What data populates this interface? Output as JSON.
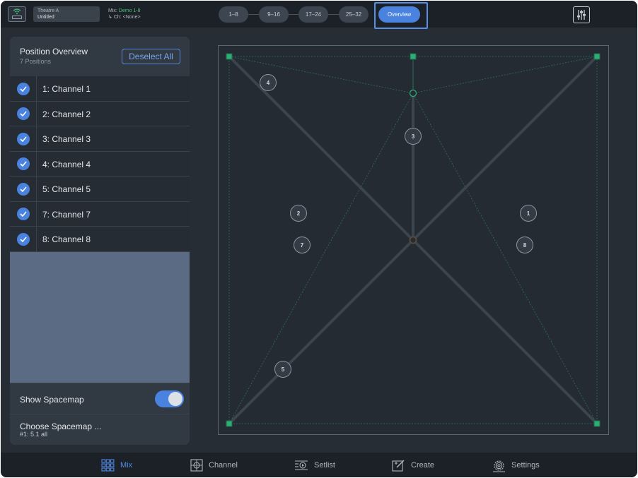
{
  "topbar": {
    "venue_name": "Theatre A",
    "venue_file": "Untitled",
    "mix_label": "Mix:",
    "mix_value": "Demo 1-8",
    "channel_label": "Ch: <None>",
    "pages": [
      "1–8",
      "9–16",
      "17–24",
      "25–32"
    ],
    "overview_label": "Overview"
  },
  "panel": {
    "title": "Position Overview",
    "subtitle": "7 Positions",
    "deselect_label": "Deselect All",
    "channels": [
      {
        "label": "1: Channel 1",
        "checked": true
      },
      {
        "label": "2: Channel 2",
        "checked": true
      },
      {
        "label": "3: Channel 3",
        "checked": true
      },
      {
        "label": "4: Channel 4",
        "checked": true
      },
      {
        "label": "5: Channel 5",
        "checked": true
      },
      {
        "label": "7: Channel 7",
        "checked": true
      },
      {
        "label": "8: Channel 8",
        "checked": true
      }
    ],
    "show_spacemap_label": "Show Spacemap",
    "show_spacemap_on": true,
    "choose_spacemap_label": "Choose Spacemap ...",
    "choose_spacemap_value": "#1: 5.1 all"
  },
  "map": {
    "positions": [
      "4",
      "3",
      "2",
      "1",
      "7",
      "8",
      "5"
    ]
  },
  "tabs": [
    {
      "label": "Mix",
      "icon": "grid-icon",
      "active": true
    },
    {
      "label": "Channel",
      "icon": "crosshair-icon",
      "active": false
    },
    {
      "label": "Setlist",
      "icon": "setlist-icon",
      "active": false
    },
    {
      "label": "Create",
      "icon": "create-icon",
      "active": false
    },
    {
      "label": "Settings",
      "icon": "gear-icon",
      "active": false
    }
  ],
  "colors": {
    "accent": "#4a82e0",
    "speaker_green": "#2fae74",
    "mix_value": "#49c27c"
  }
}
